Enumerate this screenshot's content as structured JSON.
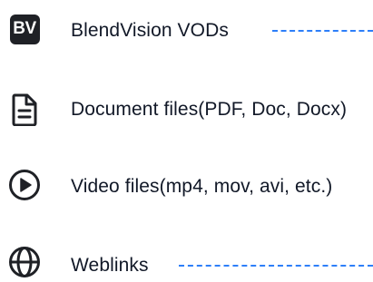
{
  "items": [
    {
      "label": "BlendVision VODs",
      "icon": "blendvision-logo-icon",
      "badge_text": "BV",
      "has_dashed_connector": true
    },
    {
      "label": "Document files(PDF, Doc, Docx)",
      "icon": "document-icon"
    },
    {
      "label": "Video files(mp4, mov, avi, etc.)",
      "icon": "play-circle-icon"
    },
    {
      "label": "Weblinks",
      "icon": "globe-icon",
      "has_dashed_connector": true
    }
  ],
  "colors": {
    "text": "#111827",
    "icon": "#1f2126",
    "connector": "#2d7ff9"
  }
}
